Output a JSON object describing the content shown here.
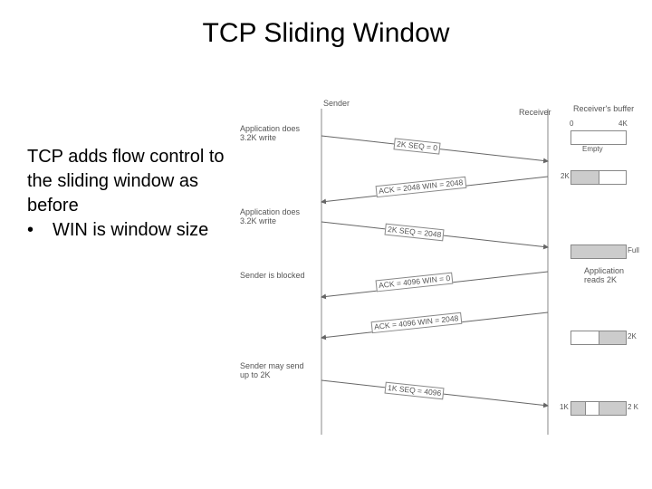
{
  "title": "TCP Sliding Window",
  "body": {
    "para": "TCP adds flow control to the sliding window as before",
    "bullet_marker": "•",
    "bullet1": "WIN is window size"
  },
  "diagram": {
    "headers": {
      "sender": "Sender",
      "receiver": "Receiver",
      "recv_buffer": "Receiver's buffer"
    },
    "annotations": {
      "app_write_1": "Application does 3.2K write",
      "app_write_2": "Application does 3.2K write",
      "sender_blocked": "Sender is blocked",
      "app_reads": "Application reads 2K",
      "sender_may_send": "Sender may send up to 2K"
    },
    "messages": {
      "m1": "2K   SEQ = 0",
      "m2": "ACK = 2048 WIN = 2048",
      "m3": "2K   SEQ = 2048",
      "m4": "ACK = 4096 WIN = 0",
      "m5": "ACK = 4096 WIN = 2048",
      "m6": "1K   SEQ = 4096"
    },
    "buffers": {
      "scale_left": "0",
      "scale_right": "4K",
      "b1_label": "Empty",
      "b2_label": "2K",
      "b3_label": "Full",
      "b4_label": "2K",
      "b5_seg1": "1K",
      "b5_seg2": "2 K"
    }
  }
}
